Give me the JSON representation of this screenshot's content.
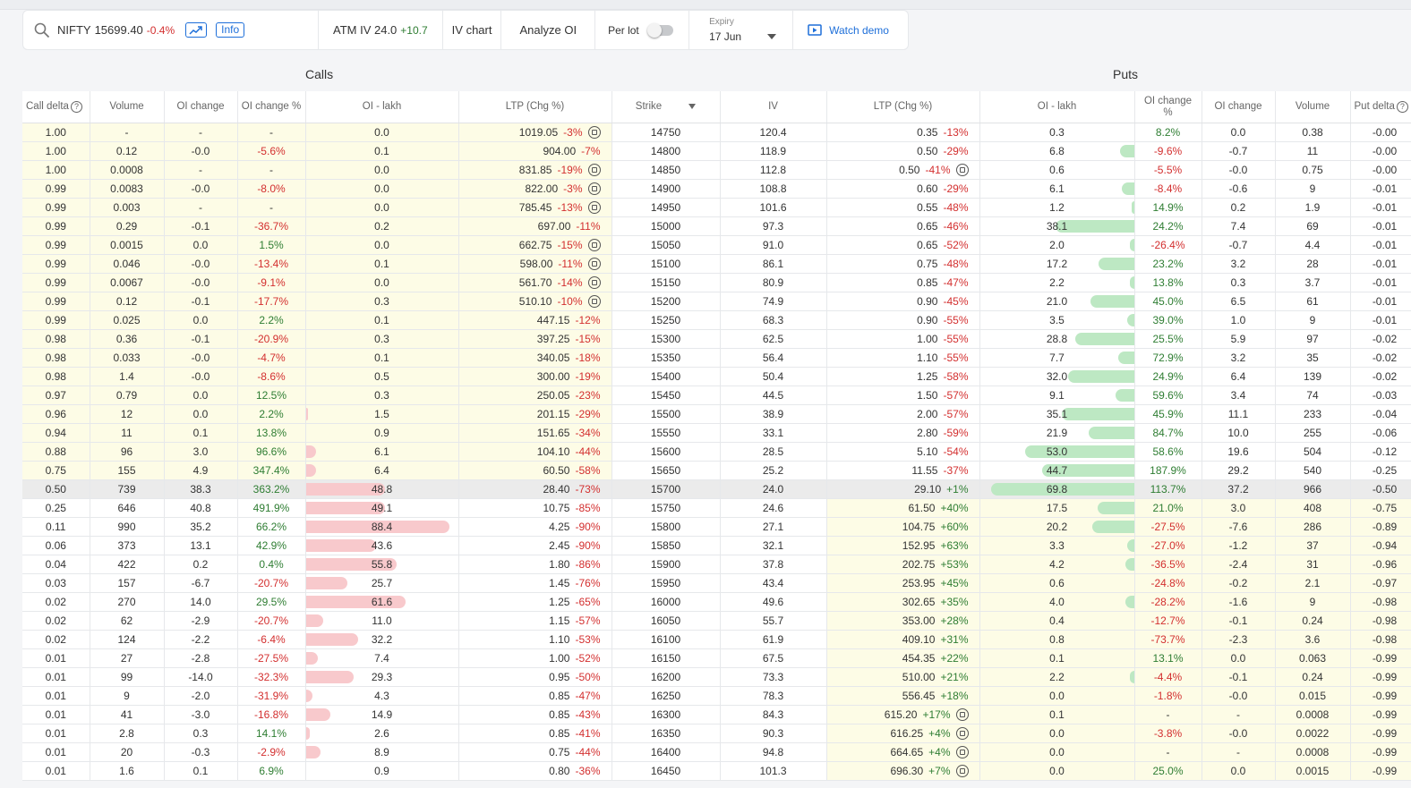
{
  "toolbar": {
    "symbol": "NIFTY",
    "price": "15699.40",
    "change": "-0.4%",
    "info_label": "Info",
    "atm_iv_label": "ATM IV 24.0",
    "atm_iv_change": "+10.7",
    "iv_chart_label": "IV chart",
    "analyze_oi_label": "Analyze OI",
    "per_lot_label": "Per lot",
    "per_lot_on": false,
    "expiry_label": "Expiry",
    "expiry_value": "17 Jun",
    "watch_demo_label": "Watch demo"
  },
  "sections": {
    "calls": "Calls",
    "puts": "Puts"
  },
  "columns": {
    "call_delta": "Call delta",
    "volume": "Volume",
    "oi_change": "OI change",
    "oi_change_pct": "OI change %",
    "oi_lakh": "OI - lakh",
    "ltp_chg": "LTP (Chg %)",
    "strike": "Strike",
    "iv": "IV",
    "put_delta": "Put delta"
  },
  "colors": {
    "itm_bg": "#fdfce6",
    "atm_bg": "#ebebeb",
    "neg": "#d32f2f",
    "pos": "#2e7d32",
    "call_bar": "#f8c9cc",
    "put_bar": "#bde8c3",
    "accent": "#1e6fd9"
  },
  "rows": [
    {
      "strike": "14750",
      "cd": "1.00",
      "cv": "-",
      "coc": "-",
      "cocp": "-",
      "coi": "0.0",
      "cltp": "1019.05",
      "cchg": "-3%",
      "clock": true,
      "iv": "120.4",
      "pltp": "0.35",
      "pchg": "-13%",
      "plock": false,
      "poi": "0.3",
      "pocp": "8.2%",
      "poc": "0.0",
      "pv": "0.38",
      "pd": "-0.00"
    },
    {
      "strike": "14800",
      "cd": "1.00",
      "cv": "0.12",
      "coc": "-0.0",
      "cocp": "-5.6%",
      "coi": "0.1",
      "cltp": "904.00",
      "cchg": "-7%",
      "clock": false,
      "iv": "118.9",
      "pltp": "0.50",
      "pchg": "-29%",
      "plock": false,
      "poi": "6.8",
      "pocp": "-9.6%",
      "poc": "-0.7",
      "pv": "11",
      "pd": "-0.00"
    },
    {
      "strike": "14850",
      "cd": "1.00",
      "cv": "0.0008",
      "coc": "-",
      "cocp": "-",
      "coi": "0.0",
      "cltp": "831.85",
      "cchg": "-19%",
      "clock": true,
      "iv": "112.8",
      "pltp": "0.50",
      "pchg": "-41%",
      "plock": true,
      "poi": "0.6",
      "pocp": "-5.5%",
      "poc": "-0.0",
      "pv": "0.75",
      "pd": "-0.00"
    },
    {
      "strike": "14900",
      "cd": "0.99",
      "cv": "0.0083",
      "coc": "-0.0",
      "cocp": "-8.0%",
      "coi": "0.0",
      "cltp": "822.00",
      "cchg": "-3%",
      "clock": true,
      "iv": "108.8",
      "pltp": "0.60",
      "pchg": "-29%",
      "plock": false,
      "poi": "6.1",
      "pocp": "-8.4%",
      "poc": "-0.6",
      "pv": "9",
      "pd": "-0.01"
    },
    {
      "strike": "14950",
      "cd": "0.99",
      "cv": "0.003",
      "coc": "-",
      "cocp": "-",
      "coi": "0.0",
      "cltp": "785.45",
      "cchg": "-13%",
      "clock": true,
      "iv": "101.6",
      "pltp": "0.55",
      "pchg": "-48%",
      "plock": false,
      "poi": "1.2",
      "pocp": "14.9%",
      "poc": "0.2",
      "pv": "1.9",
      "pd": "-0.01"
    },
    {
      "strike": "15000",
      "cd": "0.99",
      "cv": "0.29",
      "coc": "-0.1",
      "cocp": "-36.7%",
      "coi": "0.2",
      "cltp": "697.00",
      "cchg": "-11%",
      "clock": false,
      "iv": "97.3",
      "pltp": "0.65",
      "pchg": "-46%",
      "plock": false,
      "poi": "38.1",
      "pocp": "24.2%",
      "poc": "7.4",
      "pv": "69",
      "pd": "-0.01"
    },
    {
      "strike": "15050",
      "cd": "0.99",
      "cv": "0.0015",
      "coc": "0.0",
      "cocp": "1.5%",
      "coi": "0.0",
      "cltp": "662.75",
      "cchg": "-15%",
      "clock": true,
      "iv": "91.0",
      "pltp": "0.65",
      "pchg": "-52%",
      "plock": false,
      "poi": "2.0",
      "pocp": "-26.4%",
      "poc": "-0.7",
      "pv": "4.4",
      "pd": "-0.01"
    },
    {
      "strike": "15100",
      "cd": "0.99",
      "cv": "0.046",
      "coc": "-0.0",
      "cocp": "-13.4%",
      "coi": "0.1",
      "cltp": "598.00",
      "cchg": "-11%",
      "clock": true,
      "iv": "86.1",
      "pltp": "0.75",
      "pchg": "-48%",
      "plock": false,
      "poi": "17.2",
      "pocp": "23.2%",
      "poc": "3.2",
      "pv": "28",
      "pd": "-0.01"
    },
    {
      "strike": "15150",
      "cd": "0.99",
      "cv": "0.0067",
      "coc": "-0.0",
      "cocp": "-9.1%",
      "coi": "0.0",
      "cltp": "561.70",
      "cchg": "-14%",
      "clock": true,
      "iv": "80.9",
      "pltp": "0.85",
      "pchg": "-47%",
      "plock": false,
      "poi": "2.2",
      "pocp": "13.8%",
      "poc": "0.3",
      "pv": "3.7",
      "pd": "-0.01"
    },
    {
      "strike": "15200",
      "cd": "0.99",
      "cv": "0.12",
      "coc": "-0.1",
      "cocp": "-17.7%",
      "coi": "0.3",
      "cltp": "510.10",
      "cchg": "-10%",
      "clock": true,
      "iv": "74.9",
      "pltp": "0.90",
      "pchg": "-45%",
      "plock": false,
      "poi": "21.0",
      "pocp": "45.0%",
      "poc": "6.5",
      "pv": "61",
      "pd": "-0.01"
    },
    {
      "strike": "15250",
      "cd": "0.99",
      "cv": "0.025",
      "coc": "0.0",
      "cocp": "2.2%",
      "coi": "0.1",
      "cltp": "447.15",
      "cchg": "-12%",
      "clock": false,
      "iv": "68.3",
      "pltp": "0.90",
      "pchg": "-55%",
      "plock": false,
      "poi": "3.5",
      "pocp": "39.0%",
      "poc": "1.0",
      "pv": "9",
      "pd": "-0.01"
    },
    {
      "strike": "15300",
      "cd": "0.98",
      "cv": "0.36",
      "coc": "-0.1",
      "cocp": "-20.9%",
      "coi": "0.3",
      "cltp": "397.25",
      "cchg": "-15%",
      "clock": false,
      "iv": "62.5",
      "pltp": "1.00",
      "pchg": "-55%",
      "plock": false,
      "poi": "28.8",
      "pocp": "25.5%",
      "poc": "5.9",
      "pv": "97",
      "pd": "-0.02"
    },
    {
      "strike": "15350",
      "cd": "0.98",
      "cv": "0.033",
      "coc": "-0.0",
      "cocp": "-4.7%",
      "coi": "0.1",
      "cltp": "340.05",
      "cchg": "-18%",
      "clock": false,
      "iv": "56.4",
      "pltp": "1.10",
      "pchg": "-55%",
      "plock": false,
      "poi": "7.7",
      "pocp": "72.9%",
      "poc": "3.2",
      "pv": "35",
      "pd": "-0.02"
    },
    {
      "strike": "15400",
      "cd": "0.98",
      "cv": "1.4",
      "coc": "-0.0",
      "cocp": "-8.6%",
      "coi": "0.5",
      "cltp": "300.00",
      "cchg": "-19%",
      "clock": false,
      "iv": "50.4",
      "pltp": "1.25",
      "pchg": "-58%",
      "plock": false,
      "poi": "32.0",
      "pocp": "24.9%",
      "poc": "6.4",
      "pv": "139",
      "pd": "-0.02"
    },
    {
      "strike": "15450",
      "cd": "0.97",
      "cv": "0.79",
      "coc": "0.0",
      "cocp": "12.5%",
      "coi": "0.3",
      "cltp": "250.05",
      "cchg": "-23%",
      "clock": false,
      "iv": "44.5",
      "pltp": "1.50",
      "pchg": "-57%",
      "plock": false,
      "poi": "9.1",
      "pocp": "59.6%",
      "poc": "3.4",
      "pv": "74",
      "pd": "-0.03"
    },
    {
      "strike": "15500",
      "cd": "0.96",
      "cv": "12",
      "coc": "0.0",
      "cocp": "2.2%",
      "coi": "1.5",
      "cltp": "201.15",
      "cchg": "-29%",
      "clock": false,
      "iv": "38.9",
      "pltp": "2.00",
      "pchg": "-57%",
      "plock": false,
      "poi": "35.1",
      "pocp": "45.9%",
      "poc": "11.1",
      "pv": "233",
      "pd": "-0.04"
    },
    {
      "strike": "15550",
      "cd": "0.94",
      "cv": "11",
      "coc": "0.1",
      "cocp": "13.8%",
      "coi": "0.9",
      "cltp": "151.65",
      "cchg": "-34%",
      "clock": false,
      "iv": "33.1",
      "pltp": "2.80",
      "pchg": "-59%",
      "plock": false,
      "poi": "21.9",
      "pocp": "84.7%",
      "poc": "10.0",
      "pv": "255",
      "pd": "-0.06"
    },
    {
      "strike": "15600",
      "cd": "0.88",
      "cv": "96",
      "coc": "3.0",
      "cocp": "96.6%",
      "coi": "6.1",
      "cltp": "104.10",
      "cchg": "-44%",
      "clock": false,
      "iv": "28.5",
      "pltp": "5.10",
      "pchg": "-54%",
      "plock": false,
      "poi": "53.0",
      "pocp": "58.6%",
      "poc": "19.6",
      "pv": "504",
      "pd": "-0.12"
    },
    {
      "strike": "15650",
      "cd": "0.75",
      "cv": "155",
      "coc": "4.9",
      "cocp": "347.4%",
      "coi": "6.4",
      "cltp": "60.50",
      "cchg": "-58%",
      "clock": false,
      "iv": "25.2",
      "pltp": "11.55",
      "pchg": "-37%",
      "plock": false,
      "poi": "44.7",
      "pocp": "187.9%",
      "poc": "29.2",
      "pv": "540",
      "pd": "-0.25"
    },
    {
      "strike": "15700",
      "cd": "0.50",
      "cv": "739",
      "coc": "38.3",
      "cocp": "363.2%",
      "coi": "48.8",
      "cltp": "28.40",
      "cchg": "-73%",
      "clock": false,
      "iv": "24.0",
      "pltp": "29.10",
      "pchg": "+1%",
      "plock": false,
      "poi": "69.8",
      "pocp": "113.7%",
      "poc": "37.2",
      "pv": "966",
      "pd": "-0.50",
      "atm": true
    },
    {
      "strike": "15750",
      "cd": "0.25",
      "cv": "646",
      "coc": "40.8",
      "cocp": "491.9%",
      "coi": "49.1",
      "cltp": "10.75",
      "cchg": "-85%",
      "clock": false,
      "iv": "24.6",
      "pltp": "61.50",
      "pchg": "+40%",
      "plock": false,
      "poi": "17.5",
      "pocp": "21.0%",
      "poc": "3.0",
      "pv": "408",
      "pd": "-0.75"
    },
    {
      "strike": "15800",
      "cd": "0.11",
      "cv": "990",
      "coc": "35.2",
      "cocp": "66.2%",
      "coi": "88.4",
      "cltp": "4.25",
      "cchg": "-90%",
      "clock": false,
      "iv": "27.1",
      "pltp": "104.75",
      "pchg": "+60%",
      "plock": false,
      "poi": "20.2",
      "pocp": "-27.5%",
      "poc": "-7.6",
      "pv": "286",
      "pd": "-0.89"
    },
    {
      "strike": "15850",
      "cd": "0.06",
      "cv": "373",
      "coc": "13.1",
      "cocp": "42.9%",
      "coi": "43.6",
      "cltp": "2.45",
      "cchg": "-90%",
      "clock": false,
      "iv": "32.1",
      "pltp": "152.95",
      "pchg": "+63%",
      "plock": false,
      "poi": "3.3",
      "pocp": "-27.0%",
      "poc": "-1.2",
      "pv": "37",
      "pd": "-0.94"
    },
    {
      "strike": "15900",
      "cd": "0.04",
      "cv": "422",
      "coc": "0.2",
      "cocp": "0.4%",
      "coi": "55.8",
      "cltp": "1.80",
      "cchg": "-86%",
      "clock": false,
      "iv": "37.8",
      "pltp": "202.75",
      "pchg": "+53%",
      "plock": false,
      "poi": "4.2",
      "pocp": "-36.5%",
      "poc": "-2.4",
      "pv": "31",
      "pd": "-0.96"
    },
    {
      "strike": "15950",
      "cd": "0.03",
      "cv": "157",
      "coc": "-6.7",
      "cocp": "-20.7%",
      "coi": "25.7",
      "cltp": "1.45",
      "cchg": "-76%",
      "clock": false,
      "iv": "43.4",
      "pltp": "253.95",
      "pchg": "+45%",
      "plock": false,
      "poi": "0.6",
      "pocp": "-24.8%",
      "poc": "-0.2",
      "pv": "2.1",
      "pd": "-0.97"
    },
    {
      "strike": "16000",
      "cd": "0.02",
      "cv": "270",
      "coc": "14.0",
      "cocp": "29.5%",
      "coi": "61.6",
      "cltp": "1.25",
      "cchg": "-65%",
      "clock": false,
      "iv": "49.6",
      "pltp": "302.65",
      "pchg": "+35%",
      "plock": false,
      "poi": "4.0",
      "pocp": "-28.2%",
      "poc": "-1.6",
      "pv": "9",
      "pd": "-0.98"
    },
    {
      "strike": "16050",
      "cd": "0.02",
      "cv": "62",
      "coc": "-2.9",
      "cocp": "-20.7%",
      "coi": "11.0",
      "cltp": "1.15",
      "cchg": "-57%",
      "clock": false,
      "iv": "55.7",
      "pltp": "353.00",
      "pchg": "+28%",
      "plock": false,
      "poi": "0.4",
      "pocp": "-12.7%",
      "poc": "-0.1",
      "pv": "0.24",
      "pd": "-0.98"
    },
    {
      "strike": "16100",
      "cd": "0.02",
      "cv": "124",
      "coc": "-2.2",
      "cocp": "-6.4%",
      "coi": "32.2",
      "cltp": "1.10",
      "cchg": "-53%",
      "clock": false,
      "iv": "61.9",
      "pltp": "409.10",
      "pchg": "+31%",
      "plock": false,
      "poi": "0.8",
      "pocp": "-73.7%",
      "poc": "-2.3",
      "pv": "3.6",
      "pd": "-0.98"
    },
    {
      "strike": "16150",
      "cd": "0.01",
      "cv": "27",
      "coc": "-2.8",
      "cocp": "-27.5%",
      "coi": "7.4",
      "cltp": "1.00",
      "cchg": "-52%",
      "clock": false,
      "iv": "67.5",
      "pltp": "454.35",
      "pchg": "+22%",
      "plock": false,
      "poi": "0.1",
      "pocp": "13.1%",
      "poc": "0.0",
      "pv": "0.063",
      "pd": "-0.99"
    },
    {
      "strike": "16200",
      "cd": "0.01",
      "cv": "99",
      "coc": "-14.0",
      "cocp": "-32.3%",
      "coi": "29.3",
      "cltp": "0.95",
      "cchg": "-50%",
      "clock": false,
      "iv": "73.3",
      "pltp": "510.00",
      "pchg": "+21%",
      "plock": false,
      "poi": "2.2",
      "pocp": "-4.4%",
      "poc": "-0.1",
      "pv": "0.24",
      "pd": "-0.99"
    },
    {
      "strike": "16250",
      "cd": "0.01",
      "cv": "9",
      "coc": "-2.0",
      "cocp": "-31.9%",
      "coi": "4.3",
      "cltp": "0.85",
      "cchg": "-47%",
      "clock": false,
      "iv": "78.3",
      "pltp": "556.45",
      "pchg": "+18%",
      "plock": false,
      "poi": "0.0",
      "pocp": "-1.8%",
      "poc": "-0.0",
      "pv": "0.015",
      "pd": "-0.99"
    },
    {
      "strike": "16300",
      "cd": "0.01",
      "cv": "41",
      "coc": "-3.0",
      "cocp": "-16.8%",
      "coi": "14.9",
      "cltp": "0.85",
      "cchg": "-43%",
      "clock": false,
      "iv": "84.3",
      "pltp": "615.20",
      "pchg": "+17%",
      "plock": true,
      "poi": "0.1",
      "pocp": "-",
      "poc": "-",
      "pv": "0.0008",
      "pd": "-0.99"
    },
    {
      "strike": "16350",
      "cd": "0.01",
      "cv": "2.8",
      "coc": "0.3",
      "cocp": "14.1%",
      "coi": "2.6",
      "cltp": "0.85",
      "cchg": "-41%",
      "clock": false,
      "iv": "90.3",
      "pltp": "616.25",
      "pchg": "+4%",
      "plock": true,
      "poi": "0.0",
      "pocp": "-3.8%",
      "poc": "-0.0",
      "pv": "0.0022",
      "pd": "-0.99"
    },
    {
      "strike": "16400",
      "cd": "0.01",
      "cv": "20",
      "coc": "-0.3",
      "cocp": "-2.9%",
      "coi": "8.9",
      "cltp": "0.75",
      "cchg": "-44%",
      "clock": false,
      "iv": "94.8",
      "pltp": "664.65",
      "pchg": "+4%",
      "plock": true,
      "poi": "0.0",
      "pocp": "-",
      "poc": "-",
      "pv": "0.0008",
      "pd": "-0.99"
    },
    {
      "strike": "16450",
      "cd": "0.01",
      "cv": "1.6",
      "coc": "0.1",
      "cocp": "6.9%",
      "coi": "0.9",
      "cltp": "0.80",
      "cchg": "-36%",
      "clock": false,
      "iv": "101.3",
      "pltp": "696.30",
      "pchg": "+7%",
      "plock": true,
      "poi": "0.0",
      "pocp": "25.0%",
      "poc": "0.0",
      "pv": "0.0015",
      "pd": "-0.99"
    }
  ]
}
